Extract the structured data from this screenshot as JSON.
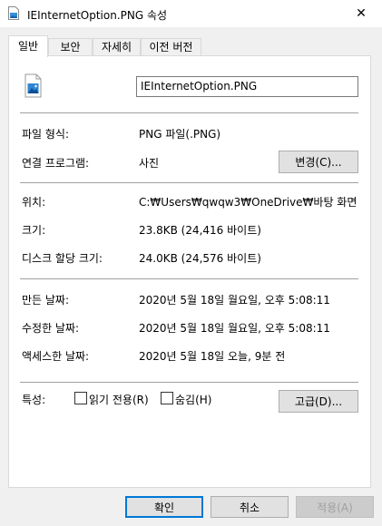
{
  "window": {
    "title": "IEInternetOption.PNG 속성",
    "title_icon": "image-file-icon",
    "close_label": "✕"
  },
  "tabs": [
    {
      "label": "일반",
      "active": true
    },
    {
      "label": "보안",
      "active": false
    },
    {
      "label": "자세히",
      "active": false
    },
    {
      "label": "이전 버전",
      "active": false
    }
  ],
  "file": {
    "icon": "png-file-icon",
    "name": "IEInternetOption.PNG"
  },
  "info": {
    "file_type_label": "파일 형식:",
    "file_type_value": "PNG 파일(.PNG)",
    "opens_with_label": "연결 프로그램:",
    "opens_with_value": "사진",
    "change_button": "변경(C)...",
    "location_label": "위치:",
    "location_value": "C:₩Users₩qwqw3₩OneDrive₩바탕 화면",
    "size_label": "크기:",
    "size_value": "23.8KB (24,416 바이트)",
    "size_on_disk_label": "디스크 할당 크기:",
    "size_on_disk_value": "24.0KB (24,576 바이트)",
    "created_label": "만든 날짜:",
    "created_value": "2020년 5월 18일 월요일, 오후 5:08:11",
    "modified_label": "수정한 날짜:",
    "modified_value": "2020년 5월 18일 월요일, 오후 5:08:11",
    "accessed_label": "액세스한 날짜:",
    "accessed_value": "2020년 5월 18일 오늘, 9분 전"
  },
  "attributes": {
    "label": "특성:",
    "readonly_label": "읽기 전용(R)",
    "readonly_checked": false,
    "hidden_label": "숨김(H)",
    "hidden_checked": false,
    "advanced_button": "고급(D)..."
  },
  "footer": {
    "ok": "확인",
    "cancel": "취소",
    "apply": "적용(A)"
  }
}
